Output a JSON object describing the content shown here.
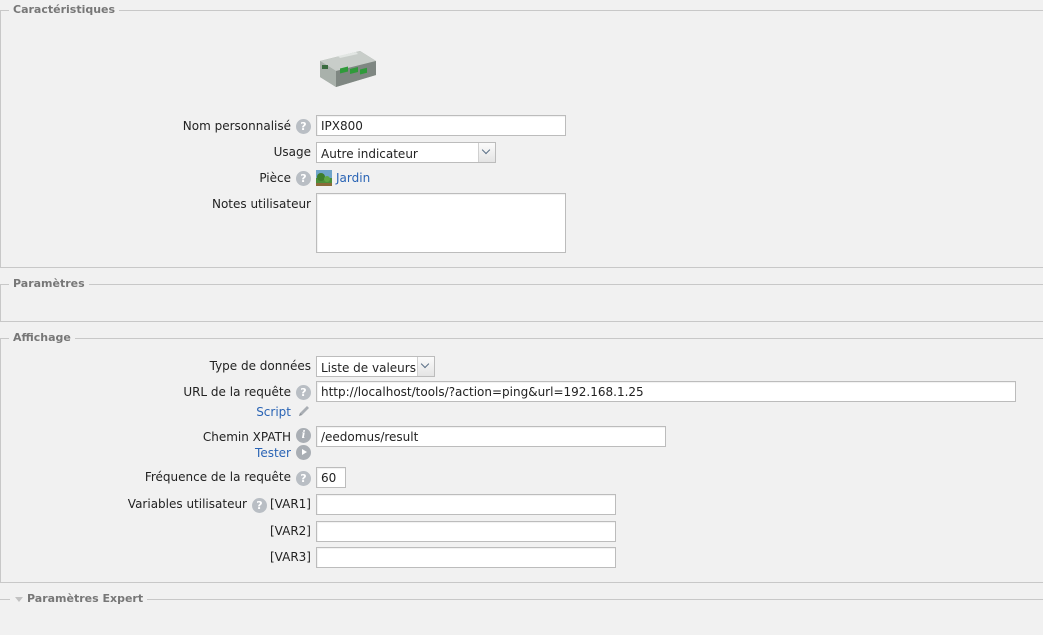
{
  "caracteristiques": {
    "title": "Caractéristiques",
    "device_image": "ipx800-device-image",
    "nom": {
      "label": "Nom personnalisé",
      "value": "IPX800"
    },
    "usage": {
      "label": "Usage",
      "value": "Autre indicateur"
    },
    "piece": {
      "label": "Pièce",
      "value": "Jardin",
      "icon": "garden-room-icon"
    },
    "notes": {
      "label": "Notes utilisateur",
      "value": ""
    }
  },
  "parametres": {
    "title": "Paramètres"
  },
  "affichage": {
    "title": "Affichage",
    "type": {
      "label": "Type de données",
      "value": "Liste de valeurs"
    },
    "url": {
      "label": "URL de la requête",
      "value": "http://localhost/tools/?action=ping&url=192.168.1.25",
      "script_link": "Script"
    },
    "xpath": {
      "label": "Chemin XPATH",
      "value": "/eedomus/result",
      "tester_link": "Tester"
    },
    "frequence": {
      "label": "Fréquence de la requête",
      "value": "60"
    },
    "variables": {
      "label": "Variables utilisateur",
      "var1_label": "[VAR1]",
      "var2_label": "[VAR2]",
      "var3_label": "[VAR3]",
      "var1": "",
      "var2": "",
      "var3": ""
    }
  },
  "expert": {
    "title": "Paramètres Expert"
  },
  "colors": {
    "background": "#f1f1f1",
    "border": "#c8c8c8",
    "legend": "#777777",
    "link": "#2a64b5",
    "help_icon": "#b9bec4"
  }
}
